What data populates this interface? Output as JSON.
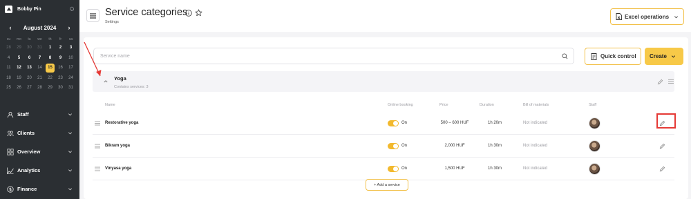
{
  "sidebar": {
    "brand": "Bobby Pin",
    "calendar": {
      "month": "August 2024",
      "weekdays": [
        "su",
        "mo",
        "tu",
        "we",
        "th",
        "fr",
        "sa"
      ],
      "weeks": [
        [
          {
            "d": "28",
            "t": "prev"
          },
          {
            "d": "29",
            "t": "prev"
          },
          {
            "d": "30",
            "t": "prev"
          },
          {
            "d": "31",
            "t": "prev"
          },
          {
            "d": "1",
            "t": "cur"
          },
          {
            "d": "2",
            "t": "cur"
          },
          {
            "d": "3",
            "t": "cur"
          }
        ],
        [
          {
            "d": "4",
            "t": "past"
          },
          {
            "d": "5",
            "t": "cur"
          },
          {
            "d": "6",
            "t": "cur"
          },
          {
            "d": "7",
            "t": "cur"
          },
          {
            "d": "8",
            "t": "cur"
          },
          {
            "d": "9",
            "t": "cur"
          },
          {
            "d": "10",
            "t": "past"
          }
        ],
        [
          {
            "d": "11",
            "t": "past"
          },
          {
            "d": "12",
            "t": "cur"
          },
          {
            "d": "13",
            "t": "cur"
          },
          {
            "d": "14",
            "t": "past"
          },
          {
            "d": "15",
            "t": "today"
          },
          {
            "d": "16",
            "t": "past"
          },
          {
            "d": "17",
            "t": "past"
          }
        ],
        [
          {
            "d": "18",
            "t": "past"
          },
          {
            "d": "19",
            "t": "past"
          },
          {
            "d": "20",
            "t": "past"
          },
          {
            "d": "21",
            "t": "past"
          },
          {
            "d": "22",
            "t": "past"
          },
          {
            "d": "23",
            "t": "past"
          },
          {
            "d": "24",
            "t": "past"
          }
        ],
        [
          {
            "d": "25",
            "t": "past"
          },
          {
            "d": "26",
            "t": "past"
          },
          {
            "d": "27",
            "t": "past"
          },
          {
            "d": "28",
            "t": "past"
          },
          {
            "d": "29",
            "t": "past"
          },
          {
            "d": "30",
            "t": "past"
          },
          {
            "d": "31",
            "t": "past"
          }
        ]
      ]
    },
    "nav": [
      {
        "label": "Staff",
        "icon": "staff-icon"
      },
      {
        "label": "Clients",
        "icon": "clients-icon"
      },
      {
        "label": "Overview",
        "icon": "overview-icon"
      },
      {
        "label": "Analytics",
        "icon": "analytics-icon"
      },
      {
        "label": "Finance",
        "icon": "finance-icon"
      }
    ]
  },
  "header": {
    "title": "Service categories",
    "breadcrumb": "Settings",
    "excel_label": "Excel operations"
  },
  "toolbar": {
    "search_placeholder": "Service name",
    "quick_control_label": "Quick control",
    "create_label": "Create"
  },
  "category": {
    "name": "Yoga",
    "count_text": "Contains services: 3"
  },
  "columns": {
    "name": "Name",
    "online_booking": "Online booking",
    "price": "Price",
    "duration": "Duration",
    "bom": "Bill of materials",
    "staff": "Staff"
  },
  "services": [
    {
      "name": "Restorative yoga",
      "online": "On",
      "price": "500 – 600 HUF",
      "duration": "1h 20m",
      "bom": "Not indicated"
    },
    {
      "name": "Bikram yoga",
      "online": "On",
      "price": "2,000 HUF",
      "duration": "1h 30m",
      "bom": "Not indicated"
    },
    {
      "name": "Vinyasa yoga",
      "online": "On",
      "price": "1,500 HUF",
      "duration": "1h 30m",
      "bom": "Not indicated"
    }
  ],
  "add_service_label": "+ Add a service",
  "colors": {
    "accent": "#f7c948",
    "sidebar_bg": "#2b2f33",
    "annotation_red": "#e53935"
  }
}
